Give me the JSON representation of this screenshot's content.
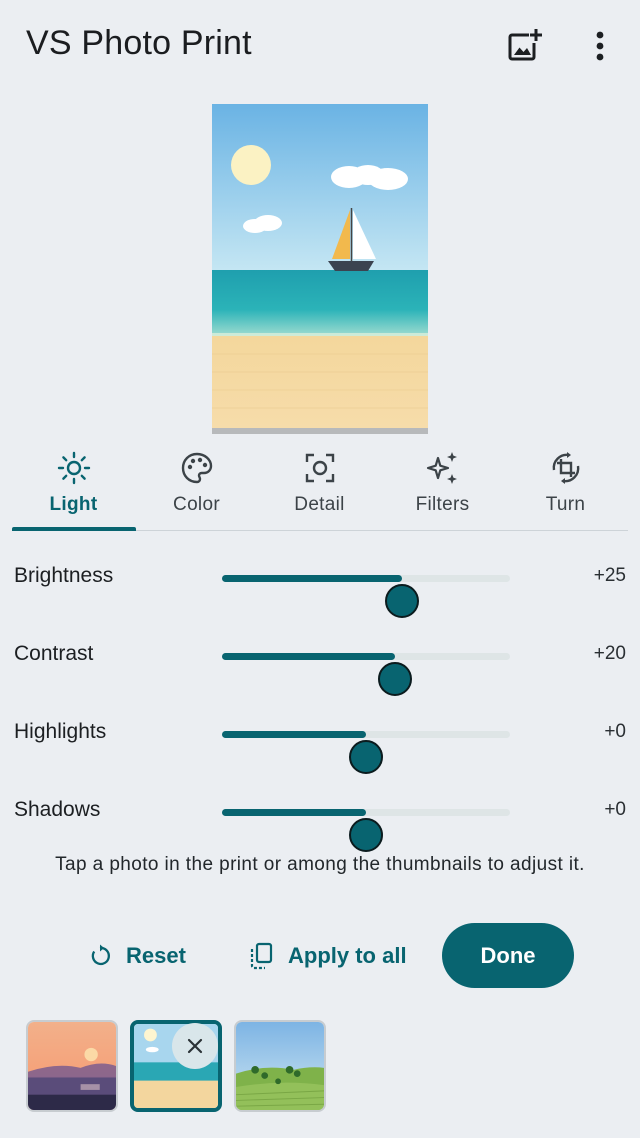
{
  "app": {
    "title": "VS Photo Print"
  },
  "toolbar": {
    "add_photo_icon": "add-photo-icon",
    "more_icon": "more-vert-icon"
  },
  "tabs": [
    {
      "label": "Light",
      "icon": "sun-icon",
      "active": true
    },
    {
      "label": "Color",
      "icon": "palette-icon",
      "active": false
    },
    {
      "label": "Detail",
      "icon": "focus-icon",
      "active": false
    },
    {
      "label": "Filters",
      "icon": "sparkle-icon",
      "active": false
    },
    {
      "label": "Turn",
      "icon": "rotate-crop-icon",
      "active": false
    }
  ],
  "adjustments": [
    {
      "label": "Brightness",
      "value_text": "+25",
      "level": 0.625
    },
    {
      "label": "Contrast",
      "value_text": "+20",
      "level": 0.6
    },
    {
      "label": "Highlights",
      "value_text": "+0",
      "level": 0.5
    },
    {
      "label": "Shadows",
      "value_text": "+0",
      "level": 0.5
    }
  ],
  "hint": "Tap a photo in the print or among the thumbnails to adjust it.",
  "actions": {
    "reset_label": "Reset",
    "apply_all_label": "Apply to all",
    "done_label": "Done"
  },
  "colors": {
    "accent": "#086470",
    "background": "#ebeef2"
  },
  "thumbnails": [
    {
      "name": "sunset",
      "selected": false
    },
    {
      "name": "beach",
      "selected": true
    },
    {
      "name": "countryside",
      "selected": false
    }
  ]
}
